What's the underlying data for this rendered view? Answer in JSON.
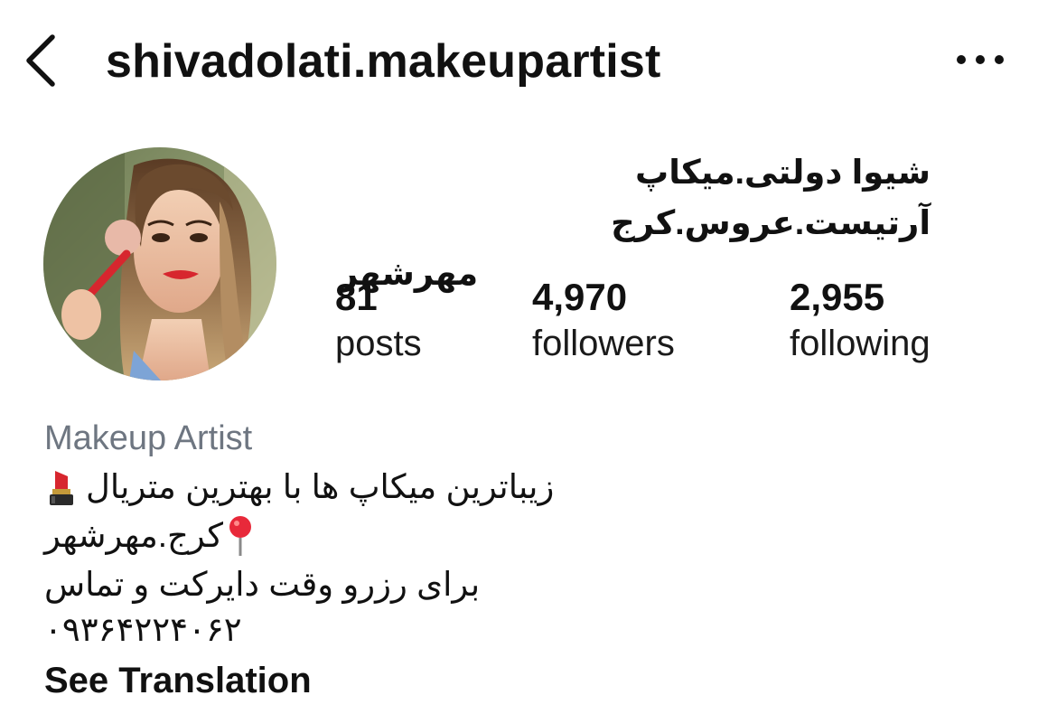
{
  "header": {
    "username": "shivadolati.makeupartist",
    "back_icon": "chevron-left-icon",
    "more_icon": "more-horizontal-icon"
  },
  "profile": {
    "full_name_line1": "شیوا دولتی.میکاپ آرتیست.عروس.کرج",
    "full_name_line2": "مهرشهر"
  },
  "stats": {
    "posts": {
      "value": "81",
      "label": "posts"
    },
    "followers": {
      "value": "4,970",
      "label": "followers"
    },
    "following": {
      "value": "2,955",
      "label": "following"
    }
  },
  "bio": {
    "category": "Makeup Artist",
    "line1": "زیباترین میکاپ ها با بهترین متریال",
    "line1_icon": "lipstick-icon",
    "line2": "کرج.مهرشهر",
    "line2_icon": "pushpin-icon",
    "line3": "برای رزرو وقت دایرکت و تماس",
    "line4": "۰۹۳۶۴۲۲۴۰۶۲",
    "see_translation": "See Translation"
  },
  "colors": {
    "text": "#111111",
    "category_gray": "#6e7681",
    "lipstick_red": "#d7262e",
    "pin_red": "#e8293a"
  }
}
